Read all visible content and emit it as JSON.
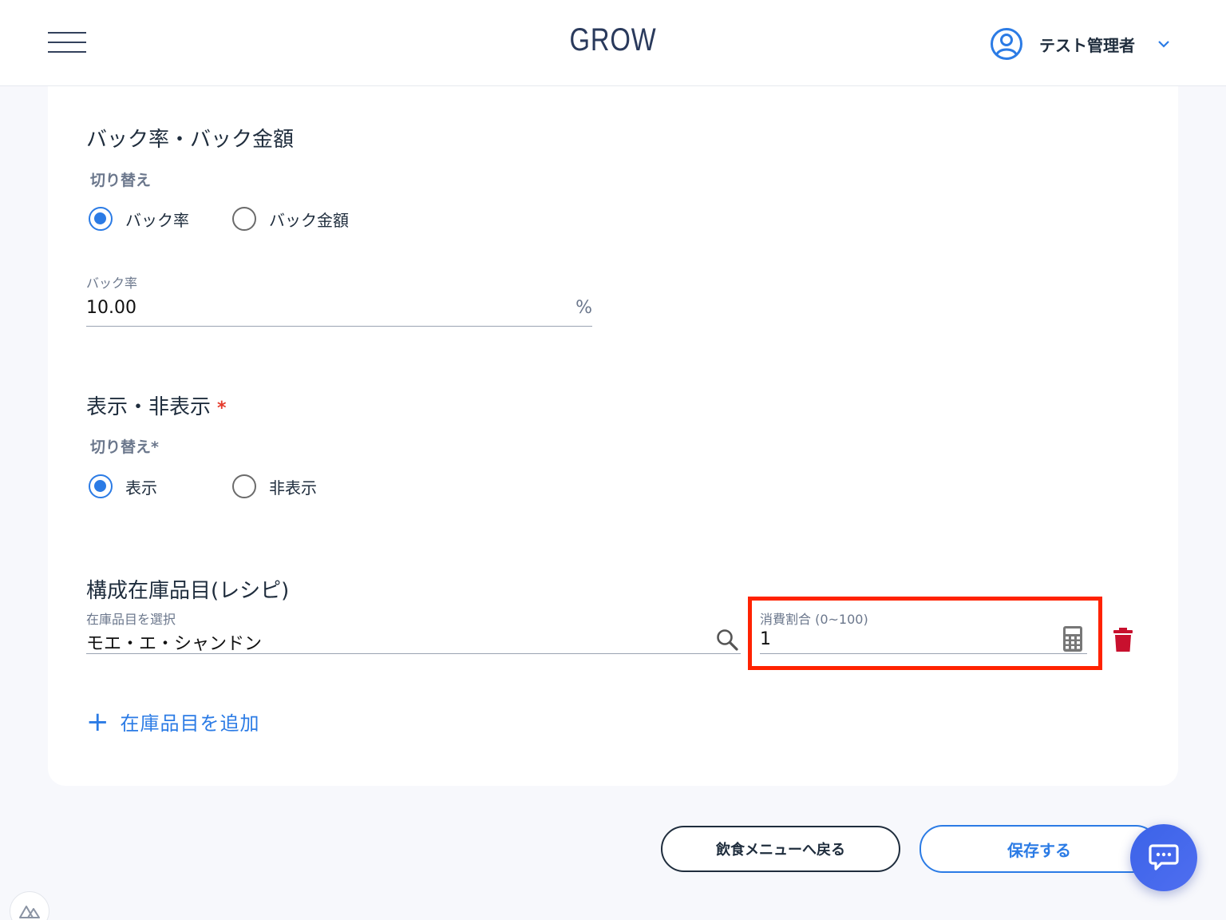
{
  "header": {
    "logo": "GROW",
    "user_name": "テスト管理者"
  },
  "back_section": {
    "title": "バック率・バック金額",
    "toggle_label": "切り替え",
    "options": [
      {
        "label": "バック率",
        "selected": true
      },
      {
        "label": "バック金額",
        "selected": false
      }
    ],
    "rate_field": {
      "label": "バック率",
      "value": "10.00",
      "suffix": "%"
    }
  },
  "display_section": {
    "title": "表示・非表示",
    "required_mark": "*",
    "toggle_label": "切り替え*",
    "options": [
      {
        "label": "表示",
        "selected": true
      },
      {
        "label": "非表示",
        "selected": false
      }
    ]
  },
  "recipe_section": {
    "title": "構成在庫品目(レシピ)",
    "item_field": {
      "label": "在庫品目を選択",
      "value": "モエ・エ・シャンドン"
    },
    "ratio_field": {
      "label": "消費割合 (0~100)",
      "value": "1"
    },
    "add_item": {
      "plus": "+",
      "label": "在庫品目を追加"
    }
  },
  "footer": {
    "back_button": "飲食メニューへ戻る",
    "save_button": "保存する"
  },
  "colors": {
    "accent": "#2b7be5",
    "highlight": "#ff2200",
    "delete": "#c8102e",
    "required": "#e53b2c"
  },
  "icons": [
    "menu-icon",
    "user-circle-icon",
    "chevron-down-icon",
    "search-icon",
    "calculator-icon",
    "trash-icon",
    "chat-icon",
    "nuxt-icon"
  ]
}
